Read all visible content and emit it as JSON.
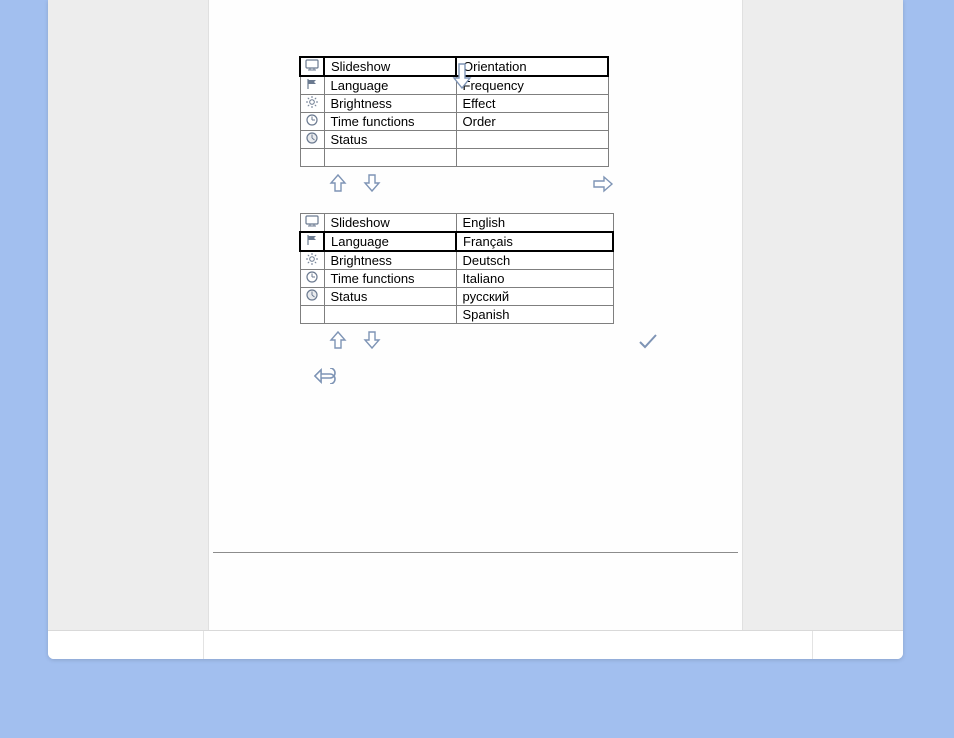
{
  "table1": {
    "left": [
      {
        "icon": "tv",
        "label": "Slideshow"
      },
      {
        "icon": "flag",
        "label": "Language"
      },
      {
        "icon": "sun",
        "label": "Brightness"
      },
      {
        "icon": "clock",
        "label": "Time functions"
      },
      {
        "icon": "clock2",
        "label": "Status"
      },
      {
        "icon": "",
        "label": ""
      }
    ],
    "right": [
      "Orientation",
      "Frequency",
      "Effect",
      "Order",
      "",
      ""
    ],
    "selectedLeftIndex": 0
  },
  "table2": {
    "left": [
      {
        "icon": "tv",
        "label": "Slideshow"
      },
      {
        "icon": "flag",
        "label": "Language"
      },
      {
        "icon": "sun",
        "label": "Brightness"
      },
      {
        "icon": "clock",
        "label": "Time functions"
      },
      {
        "icon": "clock2",
        "label": "Status"
      },
      {
        "icon": "",
        "label": ""
      }
    ],
    "right": [
      "English",
      "Français",
      "Deutsch",
      "Italiano",
      "русский",
      "Spanish"
    ],
    "selectedLeftIndex": 1
  }
}
